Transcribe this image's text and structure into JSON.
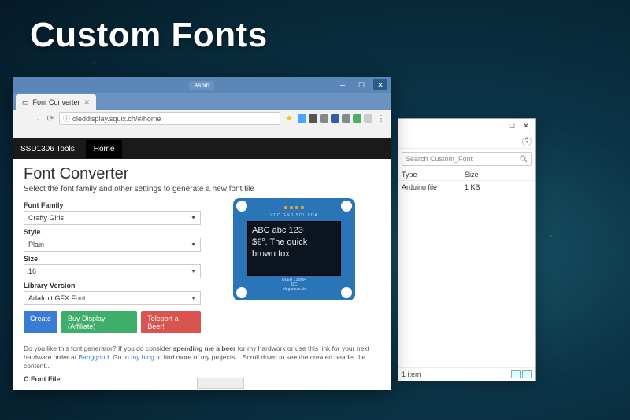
{
  "slide": {
    "title": "Custom Fonts"
  },
  "explorer": {
    "search_placeholder": "Search Custom_Font",
    "columns": {
      "type": "Type",
      "size": "Size"
    },
    "row": {
      "type": "Arduino file",
      "size": "1 KB"
    },
    "status": "1 item"
  },
  "browser": {
    "user_label": "Ashin",
    "tab_title": "Font Converter",
    "url": "oleddisplay.squix.ch/#/home",
    "navbar": {
      "brand": "SSD1306 Tools",
      "home": "Home"
    }
  },
  "page": {
    "heading": "Font Converter",
    "subheading": "Select the font family and other settings to generate a new font file",
    "labels": {
      "font_family": "Font Family",
      "style": "Style",
      "size": "Size",
      "library": "Library Version"
    },
    "values": {
      "font_family": "Crafty Girls",
      "style": "Plain",
      "size": "16",
      "library": "Adafruit GFX Font"
    },
    "buttons": {
      "create": "Create",
      "buy": "Buy Display (Affiliate)",
      "teleport": "Teleport a Beer!"
    },
    "preview": {
      "pin_labels": "VCC GND SCL SDA",
      "line1": "ABC abc 123",
      "line2": "$€°. The quick",
      "line3": "brown fox",
      "board_text1": "OLED 128x64",
      "board_text2": "I2C",
      "board_text3": "blog.squix.ch"
    },
    "footer": {
      "pre": "Do you like this font generator? If you do consider ",
      "bold": "spending me a beer",
      "mid": " for my hardwork or use this link for your next hardware order at ",
      "link1": "Banggood",
      "mid2": ". Go to ",
      "link2": "my blog",
      "post": " to find more of my projects... Scroll down to see the created header file content..."
    },
    "c_file_heading": "C Font File"
  }
}
